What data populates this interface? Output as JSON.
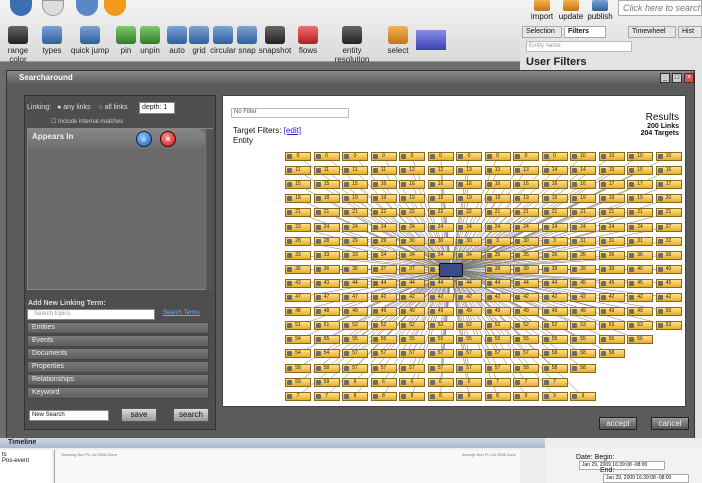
{
  "toolbar": {
    "buttons": [
      "range color",
      "types",
      "quick jump",
      "pin",
      "unpin",
      "auto",
      "grid",
      "circular",
      "snap",
      "snapshot",
      "flows",
      "entity resolution",
      "select"
    ],
    "right_buttons": [
      "import",
      "update",
      "publish"
    ],
    "search_placeholder": "Click here to search"
  },
  "right_panel": {
    "tabs": [
      "Selection",
      "Filters",
      "Timewheel",
      "Hist"
    ],
    "entity_placeholder": "Entity name",
    "title": "User Filters"
  },
  "dialog": {
    "title": "Searcharound",
    "linking": {
      "label": "Linking:",
      "option_any": "any links",
      "option_all": "all links",
      "depth_value": "depth: 1",
      "include_internal": "Include internal matches"
    },
    "appears_in": "Appears In",
    "add_term_label": "Add New Linking Term:",
    "term_placeholder": "Search topics",
    "term_link": "Search Terms",
    "sections": [
      "Entities",
      "Events",
      "Documents",
      "Properties",
      "Relationships",
      "Keyword"
    ],
    "new_search": "New Search",
    "save": "save",
    "search": "search",
    "results": {
      "filter_placeholder": "No Filter",
      "target_filters_label": "Target Filters:",
      "target_filters_link": "[edit]",
      "entity_label": "Entity",
      "title": "Results",
      "links": "200 Links",
      "targets": "204 Targets"
    },
    "grid_labels": [
      [
        "0",
        "0",
        "0",
        "0",
        "0",
        "0",
        "0",
        "0",
        "0",
        "0",
        "10",
        "10",
        "10",
        "10"
      ],
      [
        "11",
        "11",
        "11",
        "11",
        "12",
        "12",
        "13",
        "13",
        "13",
        "14",
        "14",
        "15",
        "15",
        "16"
      ],
      [
        "15",
        "15",
        "15",
        "16",
        "16",
        "16",
        "16",
        "16",
        "16",
        "16",
        "16",
        "17",
        "17",
        "17"
      ],
      [
        "18",
        "18",
        "19",
        "19",
        "19",
        "19",
        "19",
        "19",
        "19",
        "19",
        "19",
        "19",
        "19",
        "20"
      ],
      [
        "21",
        "21",
        "21",
        "22",
        "22",
        "22",
        "22",
        "21",
        "21",
        "21",
        "21",
        "21",
        "21",
        "21"
      ],
      [
        "23",
        "24",
        "24",
        "24",
        "24",
        "24",
        "24",
        "24",
        "24",
        "24",
        "24",
        "24",
        "24",
        "27"
      ],
      [
        "28",
        "28",
        "29",
        "29",
        "30",
        "30",
        "30",
        "3",
        "30",
        "3",
        "31",
        "31",
        "31",
        "32"
      ],
      [
        "33",
        "33",
        "33",
        "34",
        "34",
        "34",
        "34",
        "35",
        "35",
        "35",
        "35",
        "35",
        "36",
        "36"
      ],
      [
        "36",
        "36",
        "36",
        "37",
        "37",
        "37",
        "",
        "38",
        "39",
        "39",
        "39",
        "39",
        "40",
        "40"
      ],
      [
        "43",
        "43",
        "44",
        "44",
        "44",
        "44",
        "44",
        "44",
        "44",
        "44",
        "45",
        "45",
        "45",
        "45"
      ],
      [
        "47",
        "47",
        "47",
        "42",
        "42",
        "42",
        "42",
        "42",
        "42",
        "42",
        "42",
        "42",
        "42",
        "42"
      ],
      [
        "48",
        "48",
        "49",
        "49",
        "49",
        "49",
        "49",
        "49",
        "49",
        "49",
        "49",
        "49",
        "49",
        "50"
      ],
      [
        "51",
        "51",
        "52",
        "52",
        "52",
        "52",
        "52",
        "52",
        "52",
        "52",
        "53",
        "53",
        "53",
        "53"
      ],
      [
        "54",
        "55",
        "55",
        "55",
        "55",
        "55",
        "55",
        "55",
        "55",
        "55",
        "55",
        "56",
        "56",
        ""
      ],
      [
        "54",
        "54",
        "57",
        "57",
        "57",
        "57",
        "57",
        "57",
        "57",
        "58",
        "58",
        "58",
        "",
        ""
      ],
      [
        "58",
        "58",
        "57",
        "57",
        "57",
        "57",
        "57",
        "57",
        "58",
        "58",
        "58",
        "",
        "",
        ""
      ],
      [
        "59",
        "59",
        "6",
        "6",
        "6",
        "6",
        "6",
        "7",
        "7",
        "7",
        "",
        "",
        "",
        ""
      ],
      [
        "7",
        "7",
        "8",
        "8",
        "8",
        "8",
        "8",
        "8",
        "9",
        "9",
        "9",
        "",
        "",
        ""
      ]
    ],
    "accept": "accept",
    "cancel": "cancel"
  },
  "timeline": {
    "tab": "Timeline",
    "left_items": [
      "ts",
      "Pos-event"
    ],
    "caption_left": "Showing Sun Fri Jul 2008 Zone",
    "caption_right": "through Sun Fri Jul 2008 Zone",
    "begin_label": "Date: Begin:",
    "begin_value": "Jan 29, 2009 16:39:08 -08:00",
    "end_label": "End:",
    "end_value": "Jan 29, 2009 16:39:08 -08:00"
  }
}
